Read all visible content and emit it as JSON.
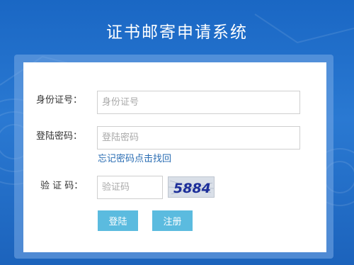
{
  "page": {
    "title": "证书邮寄申请系统"
  },
  "form": {
    "id_label": "身份证号：",
    "id_placeholder": "身份证号",
    "password_label": "登陆密码：",
    "password_placeholder": "登陆密码",
    "forgot_link": "忘记密码点击找回",
    "captcha_label": "验 证 码：",
    "captcha_placeholder": "验证码",
    "captcha_text": "5884",
    "login_button": "登陆",
    "register_button": "注册"
  },
  "colors": {
    "background": "#1f6cc8",
    "button": "#5bbbdf",
    "link": "#2a6db3",
    "captcha_text": "#1d2f9a"
  }
}
